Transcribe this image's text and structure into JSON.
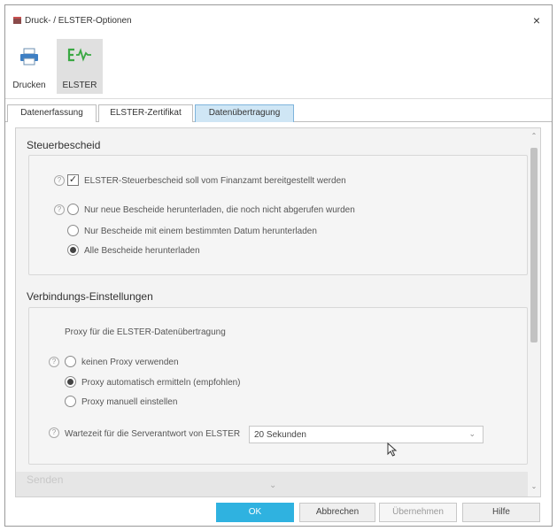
{
  "window": {
    "title": "Druck- / ELSTER-Optionen",
    "close_label": "×"
  },
  "ribbon": [
    {
      "label": "Drucken",
      "icon": "printer-icon"
    },
    {
      "label": "ELSTER",
      "icon": "elster-icon"
    }
  ],
  "tabs": [
    "Datenerfassung",
    "ELSTER-Zertifikat",
    "Datenübertragung"
  ],
  "active_tab": "Datenübertragung",
  "steuerbescheid": {
    "title": "Steuerbescheid",
    "checkbox_label": "ELSTER-Steuerbescheid soll vom Finanzamt bereitgestellt werden",
    "checkbox_checked": true,
    "options": [
      "Nur neue Bescheide herunterladen, die noch nicht abgerufen wurden",
      "Nur Bescheide mit einem bestimmten Datum herunterladen",
      "Alle Bescheide herunterladen"
    ],
    "selected_option": "Alle Bescheide herunterladen"
  },
  "verbindung": {
    "title": "Verbindungs-Einstellungen",
    "proxy_heading": "Proxy für die ELSTER-Datenübertragung",
    "options": [
      "keinen Proxy verwenden",
      "Proxy automatisch ermitteln (empfohlen)",
      "Proxy manuell einstellen"
    ],
    "selected_option": "Proxy automatisch ermitteln (empfohlen)",
    "wait_label": "Wartezeit für die Serverantwort von ELSTER",
    "wait_value": "20 Sekunden"
  },
  "senden": {
    "title": "Senden"
  },
  "buttons": {
    "ok": "OK",
    "cancel": "Abbrechen",
    "apply": "Übernehmen",
    "help": "Hilfe"
  },
  "help_glyph": "?",
  "check_glyph": "✓",
  "colors": {
    "primary_button": "#2fb2e0",
    "active_tab": "#cfe6f5",
    "elster_green": "#3aa843"
  }
}
